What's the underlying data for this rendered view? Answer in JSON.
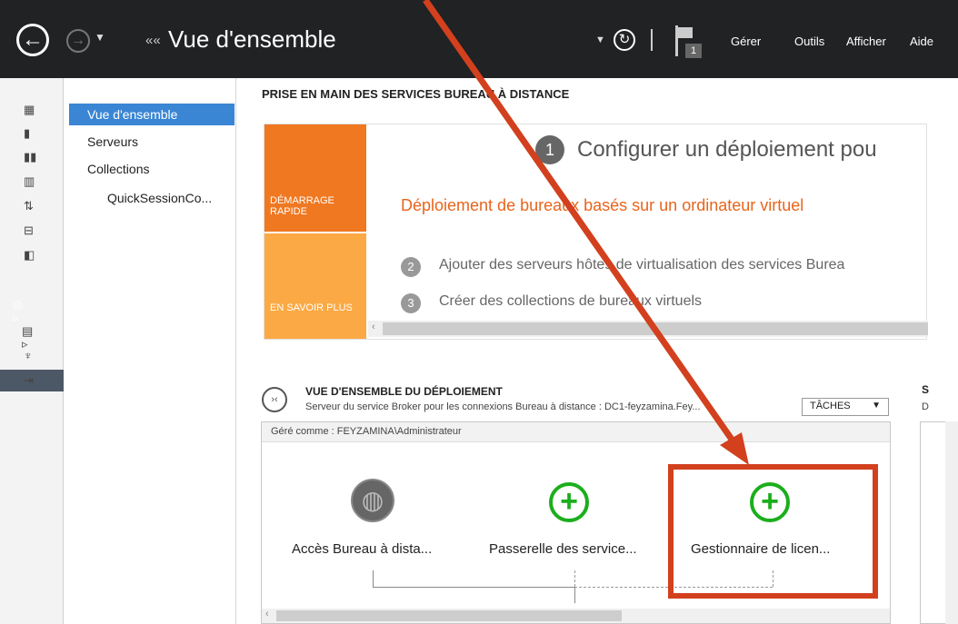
{
  "header": {
    "title": "Vue d'ensemble",
    "notification_count": "1",
    "menu": [
      "Gérer",
      "Outils",
      "Afficher",
      "Aide"
    ]
  },
  "nav": {
    "items": [
      "Vue d'ensemble",
      "Serveurs",
      "Collections",
      "QuickSessionCo..."
    ]
  },
  "quickstart": {
    "section_title": "PRISE EN MAIN DES SERVICES BUREAU À DISTANCE",
    "tile_quickstart": "DÉMARRAGE RAPIDE",
    "tile_learn": "EN SAVOIR PLUS",
    "step1_num": "1",
    "step1_text": "Configurer un déploiement pou",
    "link_text": "Déploiement de bureaux basés sur un ordinateur virtuel",
    "step2_num": "2",
    "step2_text": "Ajouter des serveurs hôtes de virtualisation des services Burea",
    "step3_num": "3",
    "step3_text": "Créer des collections de bureaux virtuels"
  },
  "deployment": {
    "title": "VUE D'ENSEMBLE DU DÉPLOIEMENT",
    "subtitle": "Serveur du service Broker pour les connexions Bureau à distance : DC1-feyzamina.Fey...",
    "tasks_button": "TÂCHES",
    "managed_as": "Géré comme : FEYZAMINA\\Administrateur",
    "roles": [
      "Accès Bureau à dista...",
      "Passerelle des service...",
      "Gestionnaire de licen..."
    ]
  },
  "right_section": {
    "title_letter": "S",
    "sub_letter": "D"
  },
  "colors": {
    "accent_orange": "#f07821",
    "annotation_red": "#d2401e",
    "add_green": "#1cae1c"
  }
}
